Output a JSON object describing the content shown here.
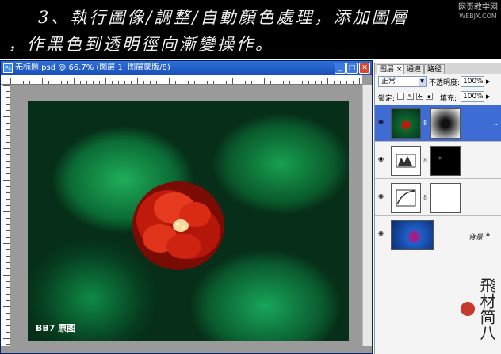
{
  "caption": {
    "line1": "3、執行圖像/調整/自動顏色處理，添加圖層",
    "line2": "，作黑色到透明徑向漸變操作。",
    "watermark": [
      "网页教学网",
      "WEBJX.COM"
    ]
  },
  "document_window": {
    "title": "无标题.psd @ 66.7% (图层 1, 图层蒙版/8)",
    "icon_label": "Ps",
    "min_glyph": "_",
    "max_glyph": "□",
    "close_glyph": "✕",
    "canvas_label": "BB7 原图"
  },
  "layers_panel": {
    "tabs": [
      "图层",
      "通道",
      "路径"
    ],
    "tab_close": "×",
    "blend_mode": "正常",
    "opacity_label": "不透明度:",
    "opacity_value": "100%",
    "lock_label": "锁定:",
    "fill_label": "填充:",
    "fill_value": "100%",
    "layers": [
      {
        "name": "",
        "selected": true,
        "kind": "photo-with-mask"
      },
      {
        "name": "",
        "selected": false,
        "kind": "levels-adjustment"
      },
      {
        "name": "",
        "selected": false,
        "kind": "curves-adjustment"
      },
      {
        "name": "背景",
        "selected": false,
        "kind": "background"
      }
    ]
  },
  "seal_text": "飛材简八"
}
